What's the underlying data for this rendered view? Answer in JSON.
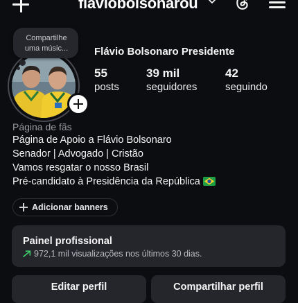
{
  "header": {
    "username": "flaviobolsonarou",
    "icons": {
      "create": "plus-icon",
      "switch_account": "chevron-down-icon",
      "threads": "threads-icon",
      "menu": "hamburger-menu-icon"
    }
  },
  "profile": {
    "note": "Compartilhe uma músic...",
    "display_name": "Flávio Bolsonaro Presidente",
    "stats": [
      {
        "value": "55",
        "label": "posts"
      },
      {
        "value": "39 mil",
        "label": "seguidores"
      },
      {
        "value": "42",
        "label": "seguindo"
      }
    ]
  },
  "bio": {
    "category": "Página de fãs",
    "lines": [
      "Página de Apoio a Flávio Bolsonaro",
      "Senador | Advogado | Cristão",
      "Vamos resgatar o nosso Brasil",
      "Pré-candidato à Presidência da República"
    ],
    "flag_emoji": "brazil-flag"
  },
  "banners": {
    "label": "Adicionar banners"
  },
  "professional_panel": {
    "title": "Painel profissional",
    "stats_text": "972,1 mil visualizações nos últimos 30 dias."
  },
  "actions": {
    "edit_profile": "Editar perfil",
    "share_profile": "Compartilhar perfil"
  },
  "colors": {
    "background": "#0c0d10",
    "card": "#25262c",
    "trend_green": "#3ecf6c"
  }
}
